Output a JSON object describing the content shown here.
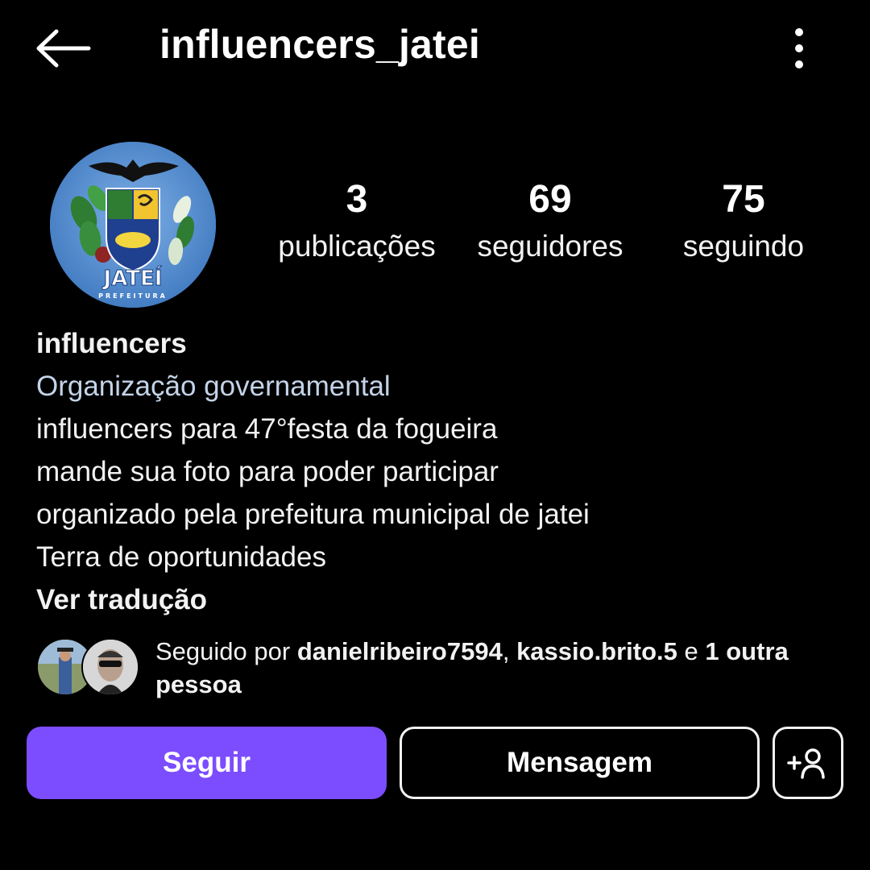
{
  "header": {
    "title": "influencers_jatei",
    "back_icon": "arrow-left-icon",
    "more_icon": "more-vertical-icon"
  },
  "profile": {
    "avatar_logo_text": "JATEÍ",
    "avatar_logo_subtext": "PREFEITURA"
  },
  "stats": [
    {
      "value": "3",
      "label": "publicações"
    },
    {
      "value": "69",
      "label": "seguidores"
    },
    {
      "value": "75",
      "label": "seguindo"
    }
  ],
  "bio": {
    "name": "influencers",
    "category": "Organização governamental",
    "lines": [
      "influencers para 47°festa  da fogueira",
      "mande sua foto para poder participar",
      "organizado pela prefeitura municipal de jatei",
      "Terra de oportunidades"
    ],
    "translate": "Ver tradução"
  },
  "followed_by": {
    "prefix": "Seguido por ",
    "user1": "danielribeiro7594",
    "separator": ", ",
    "user2": "kassio.brito.5",
    "connector": " e ",
    "others": "1 outra pessoa"
  },
  "actions": {
    "follow": "Seguir",
    "message": "Mensagem",
    "suggest_icon": "add-person-icon"
  },
  "colors": {
    "background": "#000000",
    "accent": "#7c4dff",
    "category_text": "#c3d3e8"
  }
}
